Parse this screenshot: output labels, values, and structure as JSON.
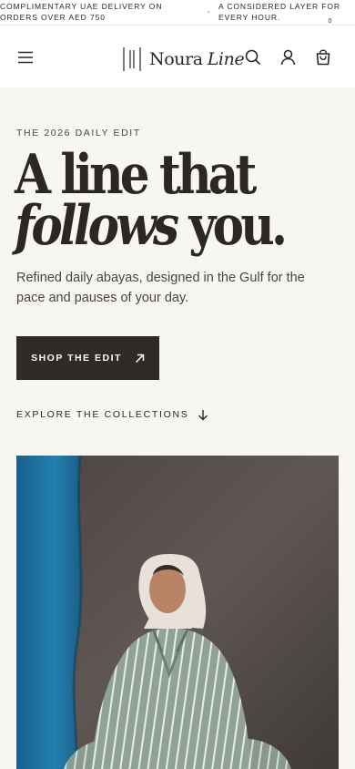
{
  "announcement": {
    "messages": [
      "COMPLIMENTARY UAE DELIVERY ON ORDERS OVER AED 750",
      "A CONSIDERED LAYER FOR EVERY HOUR."
    ]
  },
  "header": {
    "logo_word1": "Noura",
    "logo_word2": "Line",
    "cart_count": "0",
    "icons": [
      "menu-icon",
      "search-icon",
      "account-icon",
      "bag-icon"
    ]
  },
  "hero": {
    "eyebrow": "THE 2026 DAILY EDIT",
    "headline_line1": "A line that",
    "headline_italic": "follows",
    "headline_rest": " you.",
    "subtitle": "Refined daily abayas, designed in the Gulf for the pace and pauses of your day.",
    "cta_label": "SHOP THE EDIT",
    "explore_label": "EXPLORE THE COLLECTIONS"
  },
  "colors": {
    "ink": "#2b2724",
    "hero_bg": "#f7f6f2",
    "button_bg": "#2f2b28",
    "backdrop_blue": "#1f6f9c",
    "garment": "#8fa293"
  }
}
